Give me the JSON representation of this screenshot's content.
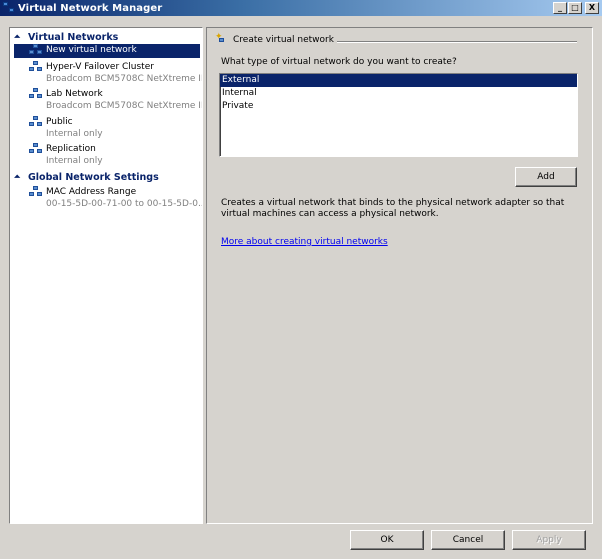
{
  "window": {
    "title": "Virtual Network Manager",
    "buttons": [
      "_",
      "□",
      "X"
    ]
  },
  "tree": {
    "virtual_networks_header": "Virtual Networks",
    "items": [
      {
        "label": "New virtual network",
        "sub": ""
      },
      {
        "label": "Hyper-V Failover Cluster",
        "sub": "Broadcom BCM5708C NetXtreme II..."
      },
      {
        "label": "Lab Network",
        "sub": "Broadcom BCM5708C NetXtreme II..."
      },
      {
        "label": "Public",
        "sub": "Internal only"
      },
      {
        "label": "Replication",
        "sub": "Internal only"
      }
    ],
    "global_header": "Global Network Settings",
    "global_items": [
      {
        "label": "MAC Address Range",
        "sub": "00-15-5D-00-71-00 to 00-15-5D-0..."
      }
    ]
  },
  "panel": {
    "section_title": "Create virtual network",
    "question": "What type of virtual network do you want to create?",
    "types": [
      "External",
      "Internal",
      "Private"
    ],
    "selected_type": "External",
    "add_label": "Add",
    "description": "Creates a virtual network that binds to the physical network adapter so that virtual machines can access a physical network.",
    "link": "More about creating virtual networks"
  },
  "footer": {
    "ok": "OK",
    "cancel": "Cancel",
    "apply": "Apply"
  }
}
